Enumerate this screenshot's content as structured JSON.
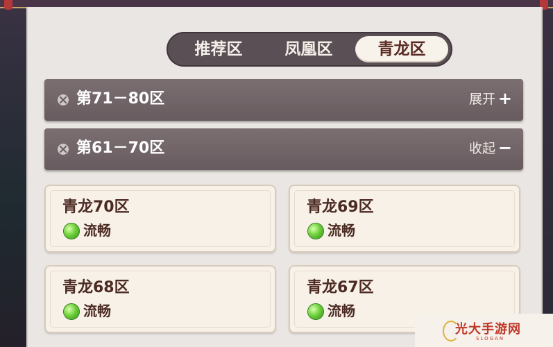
{
  "tabs": [
    {
      "label": "推荐区",
      "active": false
    },
    {
      "label": "凤凰区",
      "active": false
    },
    {
      "label": "青龙区",
      "active": true
    }
  ],
  "groups": [
    {
      "title": "第71－80区",
      "action": "展开",
      "sign": "+"
    },
    {
      "title": "第61－70区",
      "action": "收起",
      "sign": "−"
    }
  ],
  "servers": [
    {
      "name": "青龙70区",
      "status": "流畅"
    },
    {
      "name": "青龙69区",
      "status": "流畅"
    },
    {
      "name": "青龙68区",
      "status": "流畅"
    },
    {
      "name": "青龙67区",
      "status": "流畅"
    }
  ],
  "watermark": {
    "text": "光大手游网",
    "sub": "SLOGAN"
  },
  "colors": {
    "active_tab_text": "#5a2a24",
    "status_green": "#6fd13a",
    "group_bar": "#6f6366"
  }
}
